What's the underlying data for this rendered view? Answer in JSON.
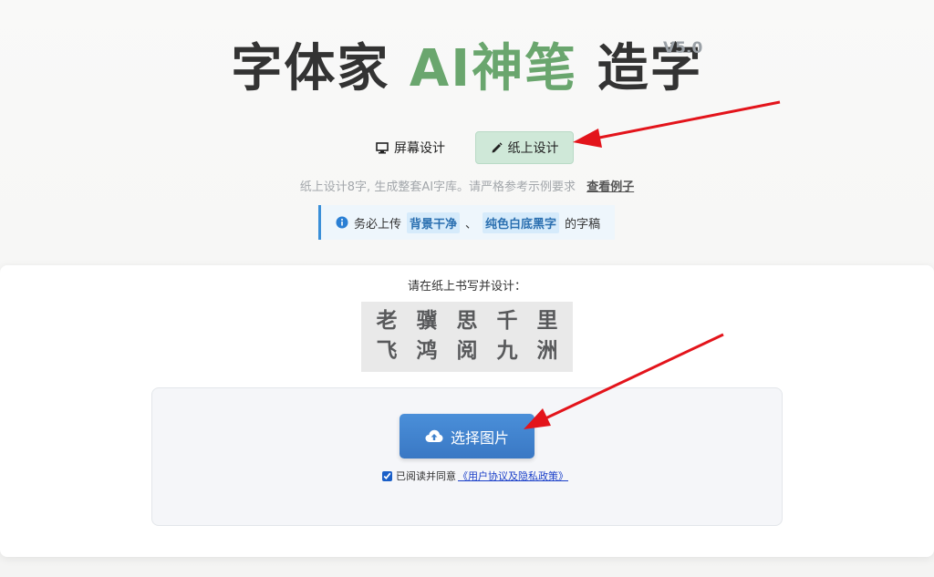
{
  "header": {
    "title_part1": "字体家",
    "title_accent": "AI神笔",
    "title_part2": "造字",
    "version": "V5.0"
  },
  "modes": [
    {
      "label": "屏幕设计",
      "icon": "monitor-icon",
      "active": false
    },
    {
      "label": "纸上设计",
      "icon": "pencil-icon",
      "active": true
    }
  ],
  "description": {
    "text": "纸上设计8字, 生成整套AI字库。请严格参考示例要求",
    "link": "查看例子"
  },
  "notice": {
    "icon": "info-icon",
    "prefix": "务必上传",
    "tag1": "背景干净",
    "separator": "、",
    "tag2": "纯色白底黑字",
    "suffix": "的字稿"
  },
  "sample": {
    "prompt": "请在纸上书写并设计：",
    "chars": [
      "老",
      "骥",
      "思",
      "千",
      "里",
      "飞",
      "鸿",
      "阅",
      "九",
      "洲"
    ]
  },
  "upload": {
    "button_label": "选择图片",
    "button_icon": "cloud-upload-icon",
    "agree_text": "已阅读并同意",
    "policy_link": "《用户协议及隐私政策》",
    "agree_checked": true
  },
  "colors": {
    "accent_green": "#6aa66e",
    "active_tab_bg": "#cfe8d8",
    "primary_blue": "#3a78c4",
    "annotation_arrow": "#e3141b"
  }
}
